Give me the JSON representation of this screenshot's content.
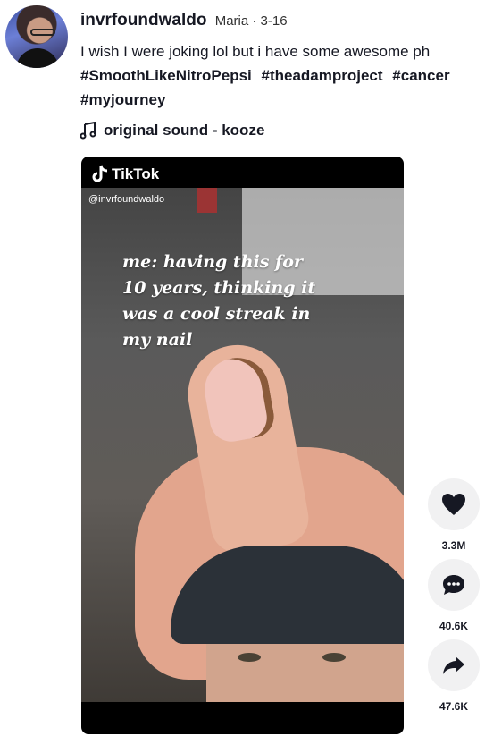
{
  "post": {
    "username": "invrfoundwaldo",
    "nickname": "Maria · 3-16",
    "caption": "I wish I were joking lol but i have some awesome ph",
    "hashtags": [
      "#SmoothLikeNitroPepsi",
      "#theadamproject",
      "#cancer"
    ],
    "hashtags_line2": [
      "#myjourney"
    ],
    "sound": "original sound - kooze"
  },
  "video": {
    "watermark": "TikTok",
    "handle": "@invrfoundwaldo",
    "overlay_lines": [
      "me: having this for",
      "10 years, thinking it",
      "was a cool streak in",
      "my nail"
    ]
  },
  "actions": {
    "likes": "3.3M",
    "comments": "40.6K",
    "shares": "47.6K"
  },
  "icons": {
    "like": "heart-icon",
    "comment": "comment-icon",
    "share": "share-icon",
    "sound": "music-note-icon"
  }
}
